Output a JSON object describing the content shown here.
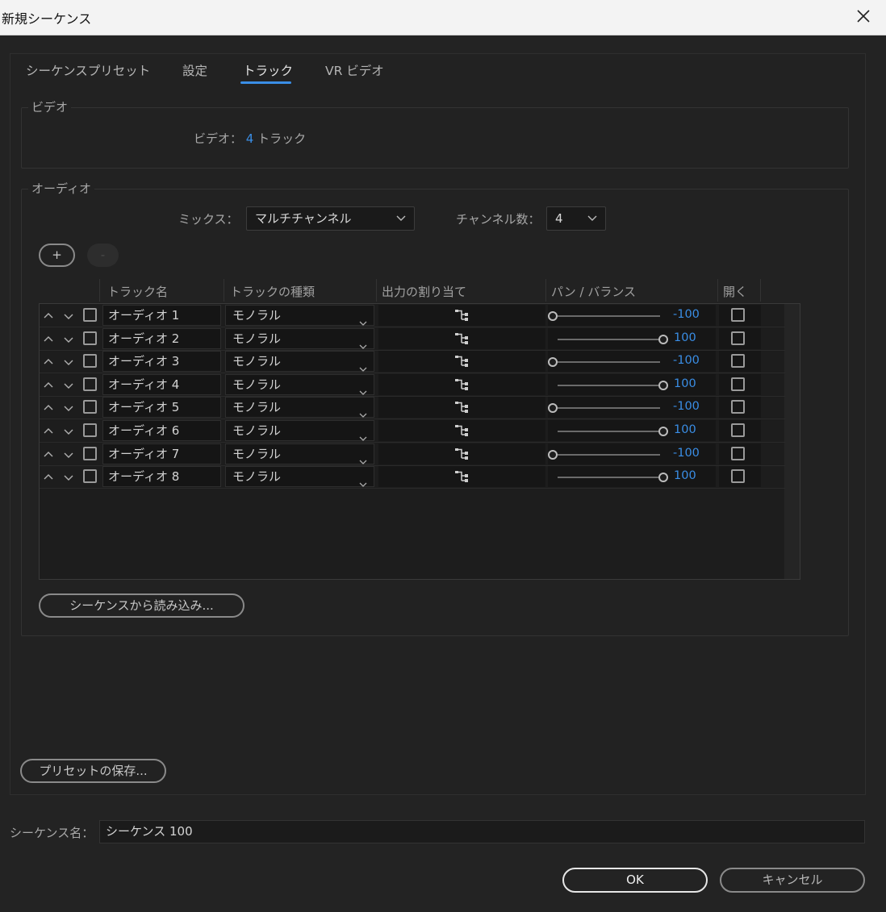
{
  "window": {
    "title": "新規シーケンス"
  },
  "tabs": [
    {
      "label": "シーケンスプリセット"
    },
    {
      "label": "設定"
    },
    {
      "label": "トラック"
    },
    {
      "label": "VR ビデオ"
    }
  ],
  "video": {
    "legend": "ビデオ",
    "label": "ビデオ：",
    "count": "4",
    "unit": "トラック"
  },
  "audio": {
    "legend": "オーディオ",
    "mix_label": "ミックス：",
    "mix_value": "マルチチャンネル",
    "channels_label": "チャンネル数：",
    "channels_value": "4",
    "add_label": "+",
    "remove_label": "-",
    "columns": [
      "トラック名",
      "トラックの種類",
      "出力の割り当て",
      "パン / バランス",
      "開く"
    ],
    "tracks": [
      {
        "name": "オーディオ 1",
        "type": "モノラル",
        "pan": "-100"
      },
      {
        "name": "オーディオ 2",
        "type": "モノラル",
        "pan": "100"
      },
      {
        "name": "オーディオ 3",
        "type": "モノラル",
        "pan": "-100"
      },
      {
        "name": "オーディオ 4",
        "type": "モノラル",
        "pan": "100"
      },
      {
        "name": "オーディオ 5",
        "type": "モノラル",
        "pan": "-100"
      },
      {
        "name": "オーディオ 6",
        "type": "モノラル",
        "pan": "100"
      },
      {
        "name": "オーディオ 7",
        "type": "モノラル",
        "pan": "-100"
      },
      {
        "name": "オーディオ 8",
        "type": "モノラル",
        "pan": "100"
      }
    ],
    "import_button": "シーケンスから読み込み..."
  },
  "save_preset_button": "プリセットの保存...",
  "sequence": {
    "label": "シーケンス名：",
    "value": "シーケンス 100"
  },
  "ok_button": "OK",
  "cancel_button": "キャンセル",
  "colors": {
    "accent": "#3a8ee6",
    "background": "#232323"
  }
}
